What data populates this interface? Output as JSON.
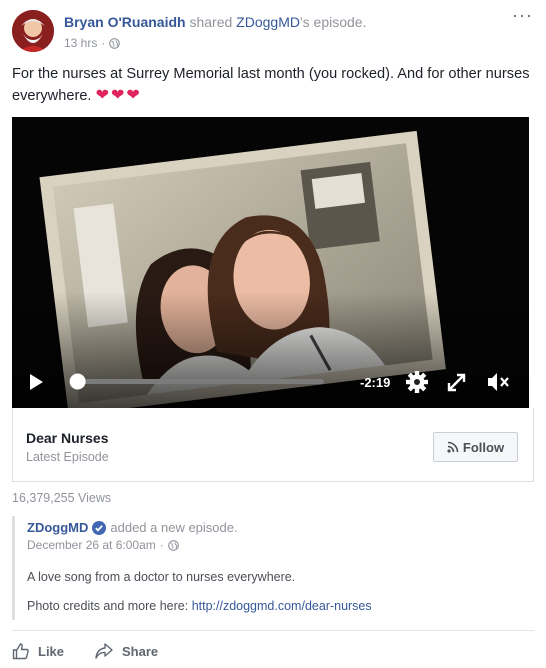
{
  "post": {
    "author": "Bryan O'Ruanaidh",
    "shared_text": "shared",
    "page_name": "ZDoggMD",
    "episode_suffix": "'s episode.",
    "timestamp": "13 hrs",
    "separator": "·",
    "more_label": "···",
    "text": "For the nurses at Surrey Memorial last month (you rocked). And for other nurses everywhere.",
    "hearts": "❤❤❤"
  },
  "video": {
    "time_remaining": "-2:19",
    "progress": 0.03
  },
  "episode": {
    "title": "Dear Nurses",
    "subtitle": "Latest Episode",
    "follow_label": "Follow"
  },
  "stats": {
    "views": "16,379,255 Views"
  },
  "quoted": {
    "page_name": "ZDoggMD",
    "action": "added a new episode.",
    "date": "December 26 at 6:00am",
    "separator": "·",
    "description": "A love song from a doctor to nurses everywhere.",
    "credits_prefix": "Photo credits and more here:",
    "credits_link": "http://zdoggmd.com/dear-nurses"
  },
  "actions": {
    "like_label": "Like",
    "share_label": "Share"
  },
  "colors": {
    "link": "#365899",
    "heart": "#e0245e",
    "muted": "#90949c"
  }
}
